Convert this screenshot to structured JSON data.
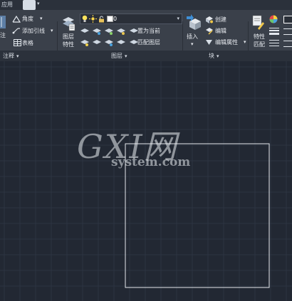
{
  "titlebar": {
    "tab_label": "应用"
  },
  "ribbon": {
    "annotation": {
      "angle_label": "角度",
      "add_leader_label": "添加引线",
      "table_label": "表格",
      "partial_label": "注",
      "group_title": "注释"
    },
    "layers": {
      "layer_properties_label_line1": "图层",
      "layer_properties_label_line2": "特性",
      "current_layer_value": "0",
      "set_current_label": "置为当前",
      "match_layer_label": "匹配图层",
      "group_title": "图层"
    },
    "block": {
      "insert_label": "插入",
      "create_label": "创建",
      "edit_label": "编辑",
      "edit_attributes_label": "编辑属性",
      "group_title": "块"
    },
    "properties": {
      "match_properties_label_line1": "特性",
      "match_properties_label_line2": "匹配"
    }
  },
  "canvas": {
    "background_color": "#222833",
    "grid_color": "#2c3441",
    "watermark_big": "GXI网",
    "watermark_small": "system.com"
  },
  "colors": {
    "ribbon_bg": "#3a404a",
    "accent_blue": "#3f8fd6"
  }
}
